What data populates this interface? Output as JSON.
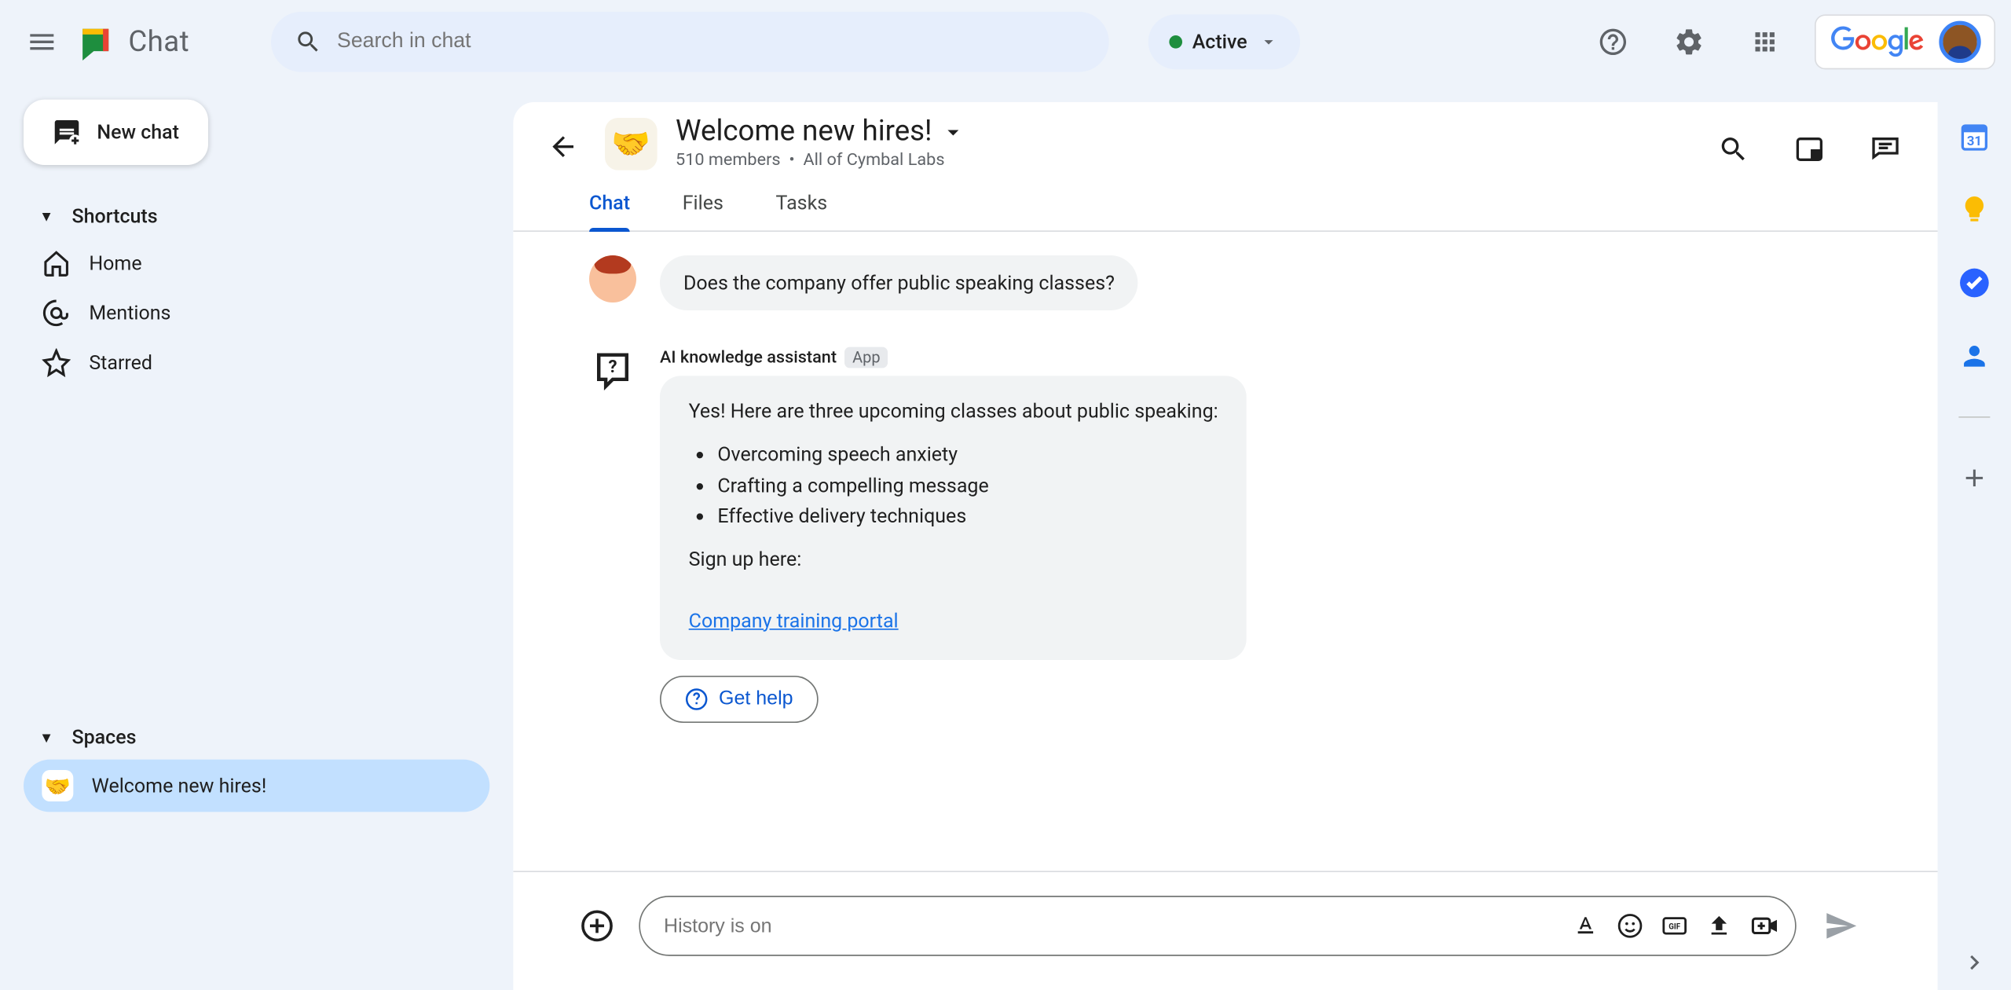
{
  "app": {
    "name": "Chat"
  },
  "search": {
    "placeholder": "Search in chat"
  },
  "status": {
    "label": "Active"
  },
  "brand": {
    "logo_text": "Google"
  },
  "newchat": {
    "label": "New chat"
  },
  "sidebar": {
    "shortcuts_header": "Shortcuts",
    "items": [
      {
        "label": "Home"
      },
      {
        "label": "Mentions"
      },
      {
        "label": "Starred"
      }
    ],
    "spaces_header": "Spaces",
    "spaces": [
      {
        "label": "Welcome new hires!",
        "emoji": "🤝"
      }
    ]
  },
  "space": {
    "emoji": "🤝",
    "title": "Welcome new hires!",
    "members": "510 members",
    "dot": "•",
    "scope": "All of Cymbal Labs",
    "tabs": [
      {
        "label": "Chat",
        "active": true
      },
      {
        "label": "Files",
        "active": false
      },
      {
        "label": "Tasks",
        "active": false
      }
    ]
  },
  "messages": {
    "user1": {
      "text": "Does the company offer public speaking classes?"
    },
    "ai": {
      "name": "AI knowledge assistant",
      "badge": "App",
      "intro": "Yes! Here are three upcoming classes about public speaking:",
      "items": [
        "Overcoming speech anxiety",
        "Crafting a compelling message",
        "Effective delivery techniques"
      ],
      "signup": "Sign up here:",
      "link": "Company training portal",
      "gethelp": "Get help"
    }
  },
  "composer": {
    "placeholder": "History is on"
  }
}
